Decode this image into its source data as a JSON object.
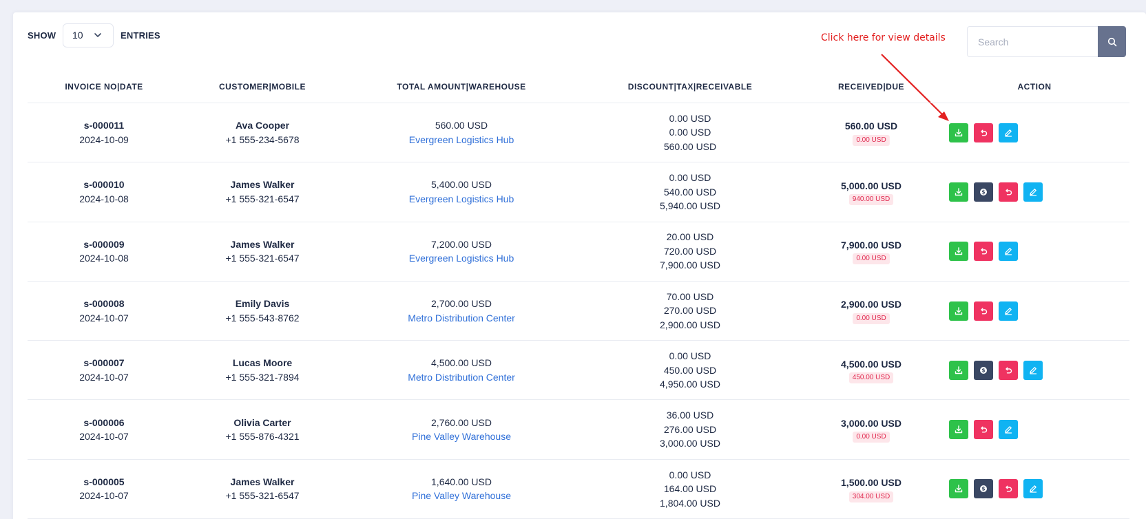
{
  "controls": {
    "show_label": "SHOW",
    "entries_label": "ENTRIES",
    "entries_value": "10",
    "search_placeholder": "Search"
  },
  "annotation": {
    "text": "Click here for view details",
    "color": "#e32020"
  },
  "table": {
    "headers": [
      "INVOICE NO|DATE",
      "CUSTOMER|MOBILE",
      "TOTAL AMOUNT|WAREHOUSE",
      "DISCOUNT|TAX|RECEIVABLE",
      "RECEIVED|DUE",
      "ACTION"
    ],
    "rows": [
      {
        "invoice": "s-000011",
        "date": "2024-10-09",
        "customer": "Ava Cooper",
        "mobile": "+1 555-234-5678",
        "total": "560.00 USD",
        "warehouse": "Evergreen Logistics Hub",
        "discount": "0.00 USD",
        "tax": "0.00 USD",
        "receivable": "560.00 USD",
        "received": "560.00 USD",
        "due": "0.00 USD",
        "actions": [
          "download-icon",
          "return-icon",
          "edit-icon"
        ]
      },
      {
        "invoice": "s-000010",
        "date": "2024-10-08",
        "customer": "James Walker",
        "mobile": "+1 555-321-6547",
        "total": "5,400.00 USD",
        "warehouse": "Evergreen Logistics Hub",
        "discount": "0.00 USD",
        "tax": "540.00 USD",
        "receivable": "5,940.00 USD",
        "received": "5,000.00 USD",
        "due": "940.00 USD",
        "actions": [
          "download-icon",
          "payment-icon",
          "return-icon",
          "edit-icon"
        ]
      },
      {
        "invoice": "s-000009",
        "date": "2024-10-08",
        "customer": "James Walker",
        "mobile": "+1 555-321-6547",
        "total": "7,200.00 USD",
        "warehouse": "Evergreen Logistics Hub",
        "discount": "20.00 USD",
        "tax": "720.00 USD",
        "receivable": "7,900.00 USD",
        "received": "7,900.00 USD",
        "due": "0.00 USD",
        "actions": [
          "download-icon",
          "return-icon",
          "edit-icon"
        ]
      },
      {
        "invoice": "s-000008",
        "date": "2024-10-07",
        "customer": "Emily Davis",
        "mobile": "+1 555-543-8762",
        "total": "2,700.00 USD",
        "warehouse": "Metro Distribution Center",
        "discount": "70.00 USD",
        "tax": "270.00 USD",
        "receivable": "2,900.00 USD",
        "received": "2,900.00 USD",
        "due": "0.00 USD",
        "actions": [
          "download-icon",
          "return-icon",
          "edit-icon"
        ]
      },
      {
        "invoice": "s-000007",
        "date": "2024-10-07",
        "customer": "Lucas Moore",
        "mobile": "+1 555-321-7894",
        "total": "4,500.00 USD",
        "warehouse": "Metro Distribution Center",
        "discount": "0.00 USD",
        "tax": "450.00 USD",
        "receivable": "4,950.00 USD",
        "received": "4,500.00 USD",
        "due": "450.00 USD",
        "actions": [
          "download-icon",
          "payment-icon",
          "return-icon",
          "edit-icon"
        ]
      },
      {
        "invoice": "s-000006",
        "date": "2024-10-07",
        "customer": "Olivia Carter",
        "mobile": "+1 555-876-4321",
        "total": "2,760.00 USD",
        "warehouse": "Pine Valley Warehouse",
        "discount": "36.00 USD",
        "tax": "276.00 USD",
        "receivable": "3,000.00 USD",
        "received": "3,000.00 USD",
        "due": "0.00 USD",
        "actions": [
          "download-icon",
          "return-icon",
          "edit-icon"
        ]
      },
      {
        "invoice": "s-000005",
        "date": "2024-10-07",
        "customer": "James Walker",
        "mobile": "+1 555-321-6547",
        "total": "1,640.00 USD",
        "warehouse": "Pine Valley Warehouse",
        "discount": "0.00 USD",
        "tax": "164.00 USD",
        "receivable": "1,804.00 USD",
        "received": "1,500.00 USD",
        "due": "304.00 USD",
        "actions": [
          "download-icon",
          "payment-icon",
          "return-icon",
          "edit-icon"
        ]
      }
    ]
  },
  "colors": {
    "background": "#eef0f7",
    "text": "#1f2a44",
    "link": "#2f6fd8",
    "download_button": "#2ec24a",
    "payment_button": "#3a4763",
    "return_button": "#ef3361",
    "edit_button": "#10b3f2",
    "search_button": "#67728e",
    "due_badge_bg": "#fde6ea",
    "due_badge_text": "#e0284e"
  }
}
